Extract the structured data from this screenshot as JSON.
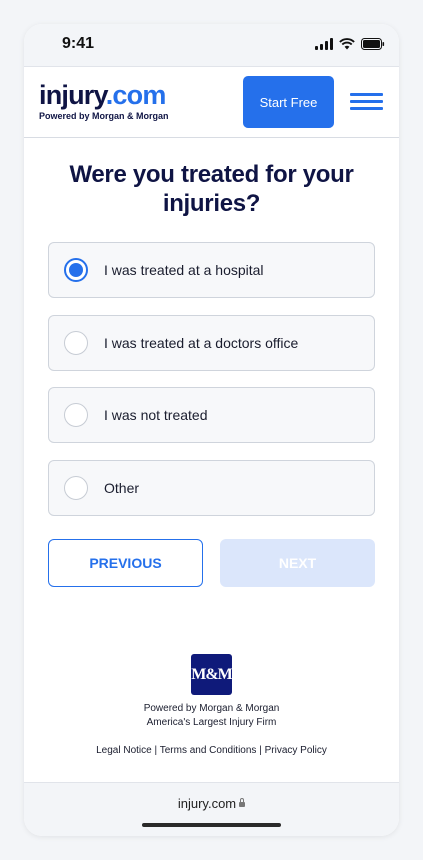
{
  "status_bar": {
    "time": "9:41"
  },
  "header": {
    "logo_injury": "injury",
    "logo_com": ".com",
    "logo_sub": "Powered by Morgan & Morgan",
    "start_button": "Start Free"
  },
  "question": "Were you treated for your injuries?",
  "options": [
    {
      "label": "I was treated at a hospital",
      "selected": true
    },
    {
      "label": "I was treated at a doctors office",
      "selected": false
    },
    {
      "label": "I was not treated",
      "selected": false
    },
    {
      "label": "Other",
      "selected": false
    }
  ],
  "buttons": {
    "previous": "PREVIOUS",
    "next": "NEXT"
  },
  "footer": {
    "badge": "M&M",
    "powered_by": "Powered by Morgan & Morgan",
    "tagline": "America's Largest Injury Firm",
    "legal_notice": "Legal Notice",
    "terms": "Terms and Conditions",
    "privacy": "Privacy Policy",
    "separator": "|"
  },
  "browser": {
    "url": "injury.com"
  },
  "colors": {
    "brand_blue": "#2570eb",
    "navy": "#0f1444",
    "next_disabled": "#dbe6fb"
  },
  "icons": [
    "signal-icon",
    "wifi-icon",
    "battery-icon",
    "hamburger-menu-icon",
    "lock-icon"
  ]
}
